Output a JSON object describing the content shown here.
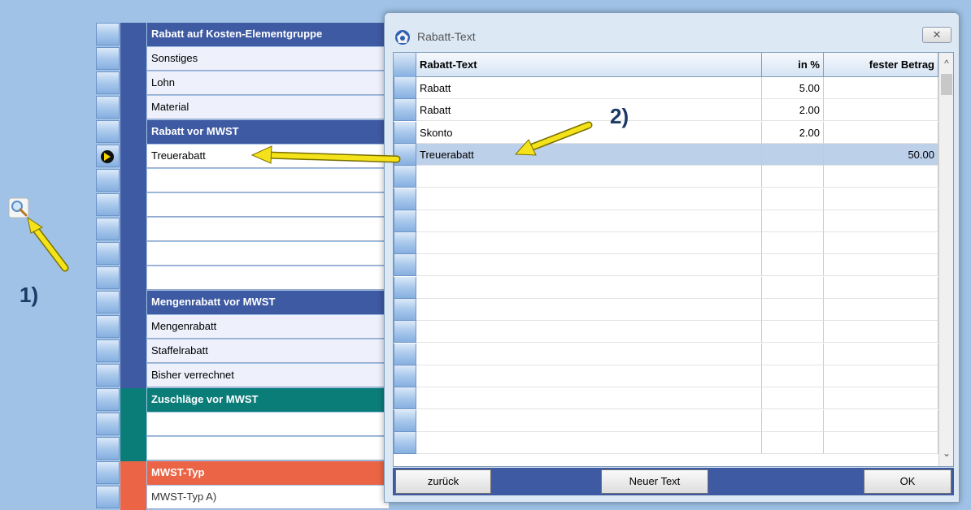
{
  "background_grid": {
    "rows": [
      {
        "text": "Rabatt auf Kosten-Elementgruppe",
        "style": "hdr"
      },
      {
        "text": "Sonstiges",
        "style": "item"
      },
      {
        "text": "Lohn",
        "style": "item"
      },
      {
        "text": "Material",
        "style": "item"
      },
      {
        "text": "Rabatt vor MWST",
        "style": "hdr"
      },
      {
        "text": "Treuerabatt",
        "style": "white",
        "current": true
      },
      {
        "text": "",
        "style": "white"
      },
      {
        "text": "",
        "style": "white"
      },
      {
        "text": "",
        "style": "white"
      },
      {
        "text": "",
        "style": "white"
      },
      {
        "text": "",
        "style": "white"
      },
      {
        "text": "Mengenrabatt vor MWST",
        "style": "hdr"
      },
      {
        "text": "Mengenrabatt",
        "style": "item"
      },
      {
        "text": "Staffelrabatt",
        "style": "item"
      },
      {
        "text": "Bisher verrechnet",
        "style": "item"
      },
      {
        "text": "Zuschläge vor MWST",
        "style": "hdr-teal"
      },
      {
        "text": "",
        "style": "teal-white"
      },
      {
        "text": "",
        "style": "teal-white"
      },
      {
        "text": "MWST-Typ",
        "style": "hdr-red"
      },
      {
        "text": "MWST-Typ A)",
        "style": "red"
      }
    ]
  },
  "annotations": {
    "label_1": "1)",
    "label_2": "2)"
  },
  "dialog": {
    "title": "Rabatt-Text",
    "close_symbol": "✕",
    "columns": [
      "Rabatt-Text",
      "in %",
      "fester Betrag"
    ],
    "rows": [
      {
        "text": "Rabatt",
        "percent": "5.00",
        "fixed": ""
      },
      {
        "text": "Rabatt",
        "percent": "2.00",
        "fixed": ""
      },
      {
        "text": "Skonto",
        "percent": "2.00",
        "fixed": ""
      },
      {
        "text": "Treuerabatt",
        "percent": "",
        "fixed": "50.00",
        "selected": true
      }
    ],
    "empty_row_count": 13,
    "scroll_up": "^",
    "scroll_down": "⌄",
    "buttons": {
      "back": "zurück",
      "new_text": "Neuer Text",
      "ok": "OK"
    }
  },
  "colors": {
    "header_blue": "#3e5aa3",
    "header_teal": "#0b7d79",
    "header_red": "#ec6446",
    "selection": "#bcd0ea",
    "arrow_yellow": "#f4e21a"
  },
  "icons": {
    "search": "magnifier-icon",
    "row_pointer": "row-pointer-icon",
    "dialog": "app-icon",
    "close": "close-icon"
  }
}
